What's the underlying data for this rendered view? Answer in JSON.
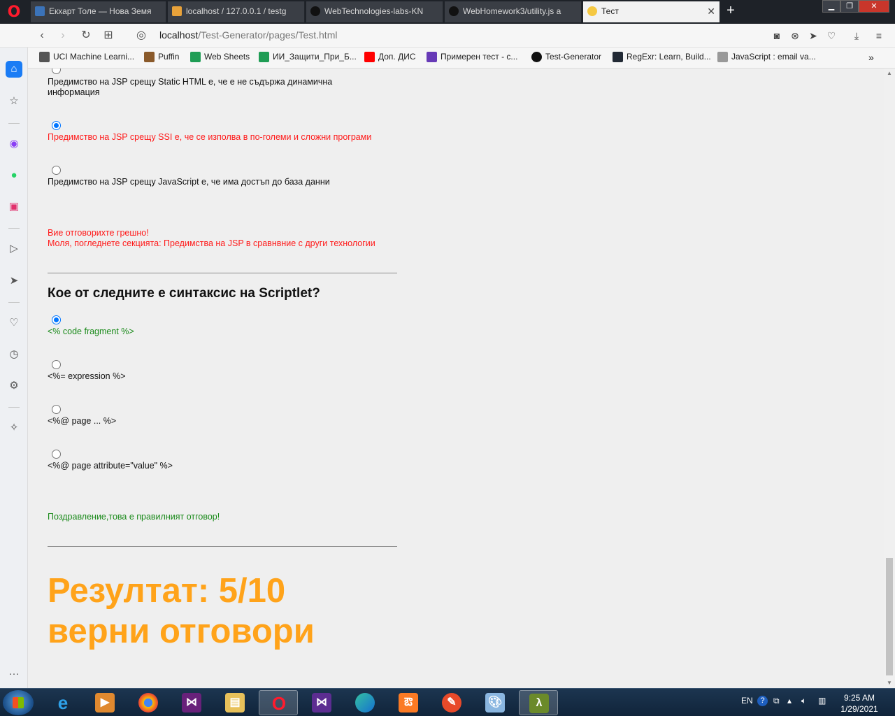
{
  "browser": {
    "tabs": [
      {
        "label": "Екхарт Толе — Нова Земя",
        "color": "#3b73b9"
      },
      {
        "label": "localhost / 127.0.0.1 / testg",
        "color": "#e8a23a"
      },
      {
        "label": "WebTechnologies-labs-KN",
        "color": "#111111"
      },
      {
        "label": "WebHomework3/utility.js a",
        "color": "#111111"
      },
      {
        "label": "Тест",
        "color": "#f5c842"
      }
    ],
    "url_host": "localhost",
    "url_path": "/Test-Generator/pages/Test.html",
    "bookmarks": [
      {
        "label": "UCI Machine Learni...",
        "color": "#555555"
      },
      {
        "label": "Puffin",
        "color": "#8a5a2b"
      },
      {
        "label": "Web Sheets",
        "color": "#1f9d55"
      },
      {
        "label": "ИИ_Защити_При_Б...",
        "color": "#1f9d55"
      },
      {
        "label": "Доп. ДИС",
        "color": "#ff0000"
      },
      {
        "label": "Примерен тест - с...",
        "color": "#673ab7"
      },
      {
        "label": "Test-Generator",
        "color": "#111111"
      },
      {
        "label": "RegExr: Learn, Build...",
        "color": "#222a35"
      },
      {
        "label": "JavaScript : email va...",
        "color": "#999999"
      }
    ]
  },
  "q1": {
    "options": [
      {
        "label_line1": "Предимство на JSP срещу Static HTML е, че е не съдържа динамична",
        "label_line2": "информация",
        "checked": false,
        "state": "normal"
      },
      {
        "label": "Предимство на JSP срещу SSI е, че се изполва в по-големи и сложни програми",
        "checked": true,
        "state": "wrong"
      },
      {
        "label": "Предимство на JSP срещу JavaScript е, че има достъп до база данни",
        "checked": false,
        "state": "normal"
      }
    ],
    "feedback_line1": "Вие отговорихте грешно!",
    "feedback_line2": "Моля, погледнете секцията: Предимства на JSP в сравнвние с други технологии"
  },
  "q2": {
    "question": "Кое от следните е синтаксис на Scriptlet?",
    "options": [
      {
        "label": "<% code fragment %>",
        "checked": true,
        "state": "right"
      },
      {
        "label": "<%= expression %>",
        "checked": false,
        "state": "normal"
      },
      {
        "label": "<%@ page ... %>",
        "checked": false,
        "state": "normal"
      },
      {
        "label": "<%@ page attribute=\"value\" %>",
        "checked": false,
        "state": "normal"
      }
    ],
    "feedback": "Поздравление,това е правилният отговор!"
  },
  "result": {
    "line1": "Резултат: 5/10",
    "line2": "верни отговори",
    "color": "#ffa31a"
  },
  "taskbar": {
    "lang": "EN",
    "time": "9:25 AM",
    "date": "1/29/2021"
  }
}
